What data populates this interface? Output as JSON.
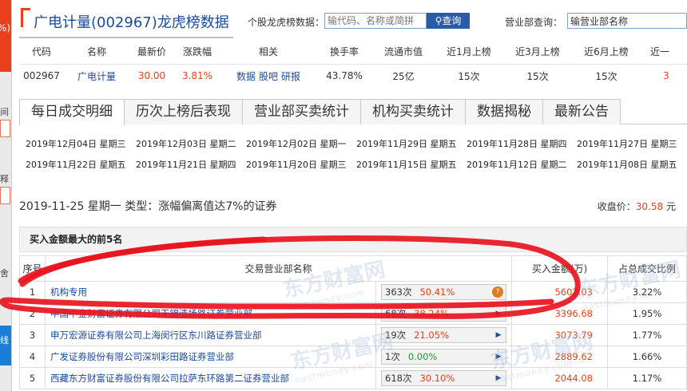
{
  "header": {
    "title": "广电计量(002967)龙虎榜数据",
    "lhb_label": "个股龙虎榜数据：",
    "lhb_placeholder": "输代码、名称或简拼",
    "search_label": "查询",
    "yyb_label": "营业部查询：",
    "yyb_value": "输营业部名称"
  },
  "summary": {
    "columns": [
      "代码",
      "名称",
      "最新价",
      "涨跌幅",
      "相关",
      "换手率",
      "流通市值",
      "近1月上榜",
      "近3月上榜",
      "近6月上榜",
      "近一"
    ],
    "row": {
      "code": "002967",
      "name": "广电计量",
      "price": "30.00",
      "change": "3.81%",
      "links": [
        "数据",
        "股吧",
        "研报"
      ],
      "turnover": "43.78%",
      "market_cap": "25亿",
      "m1": "15次",
      "m3": "15次",
      "m6": "15次",
      "y1": "3"
    }
  },
  "tabs": [
    "每日成交明细",
    "历次上榜后表现",
    "营业部买卖统计",
    "机构买卖统计",
    "数据揭秘",
    "最新公告"
  ],
  "dates": [
    [
      "2019年12月04日 星期三",
      "2019年12月03日 星期二",
      "2019年12月02日 星期一",
      "2019年11月29日 星期五",
      "2019年11月28日 星期四",
      "2019年11月27日 星期三"
    ],
    [
      "2019年11月22日 星期五",
      "2019年11月21日 星期四",
      "2019年11月20日 星期三",
      "2019年11月15日 星期五",
      "2019年11月12日 星期二",
      "2019年11月08日 星期五"
    ]
  ],
  "info": {
    "date_line": "2019-11-25 星期一   类型：涨幅偏离值达7%的证券",
    "close_label": "收盘价：",
    "close_value": "30.58",
    "close_unit": "元"
  },
  "buy_section": {
    "title": "买入金额最大的前5名",
    "columns": [
      "序号",
      "交易营业部名称",
      "",
      "买入金额(万)",
      "占总成交比例"
    ],
    "rows": [
      {
        "seq": "1",
        "name": "机构专用",
        "count": "363次",
        "pct": "50.41%",
        "pct_color": "red",
        "icon": "help",
        "amount": "5602.03",
        "ratio": "3.22%"
      },
      {
        "seq": "2",
        "name": "中国中金财富证券有限公司无锡清扬路证券营业部",
        "count": "68次",
        "pct": "38.24%",
        "pct_color": "red",
        "icon": "arrow",
        "amount": "3396.68",
        "ratio": "1.95%"
      },
      {
        "seq": "3",
        "name": "申万宏源证券有限公司上海闵行区东川路证券营业部",
        "count": "19次",
        "pct": "21.05%",
        "pct_color": "red",
        "icon": "arrow",
        "amount": "3073.79",
        "ratio": "1.77%"
      },
      {
        "seq": "4",
        "name": "广发证券股份有限公司深圳彩田路证券营业部",
        "count": "1次",
        "pct": "0.00%",
        "pct_color": "green",
        "icon": "arrow",
        "amount": "2889.62",
        "ratio": "1.66%"
      },
      {
        "seq": "5",
        "name": "西藏东方财富证券股份有限公司拉萨东环路第二证券营业部",
        "count": "618次",
        "pct": "30.10%",
        "pct_color": "red",
        "icon": "arrow",
        "amount": "2044.08",
        "ratio": "1.17%"
      }
    ]
  },
  "watermark": {
    "text": "东方财富网",
    "sub": "eastmoney.com"
  },
  "left_strip": {
    "top_text": "%)",
    "label1": "间",
    "label2": "释",
    "label3": "舍",
    "blue_text": "线"
  },
  "colors": {
    "accent_red": "#e7401a",
    "link_blue": "#1a4aa0",
    "button_blue": "#2a5ba7",
    "marker_red": "#e8141e"
  }
}
